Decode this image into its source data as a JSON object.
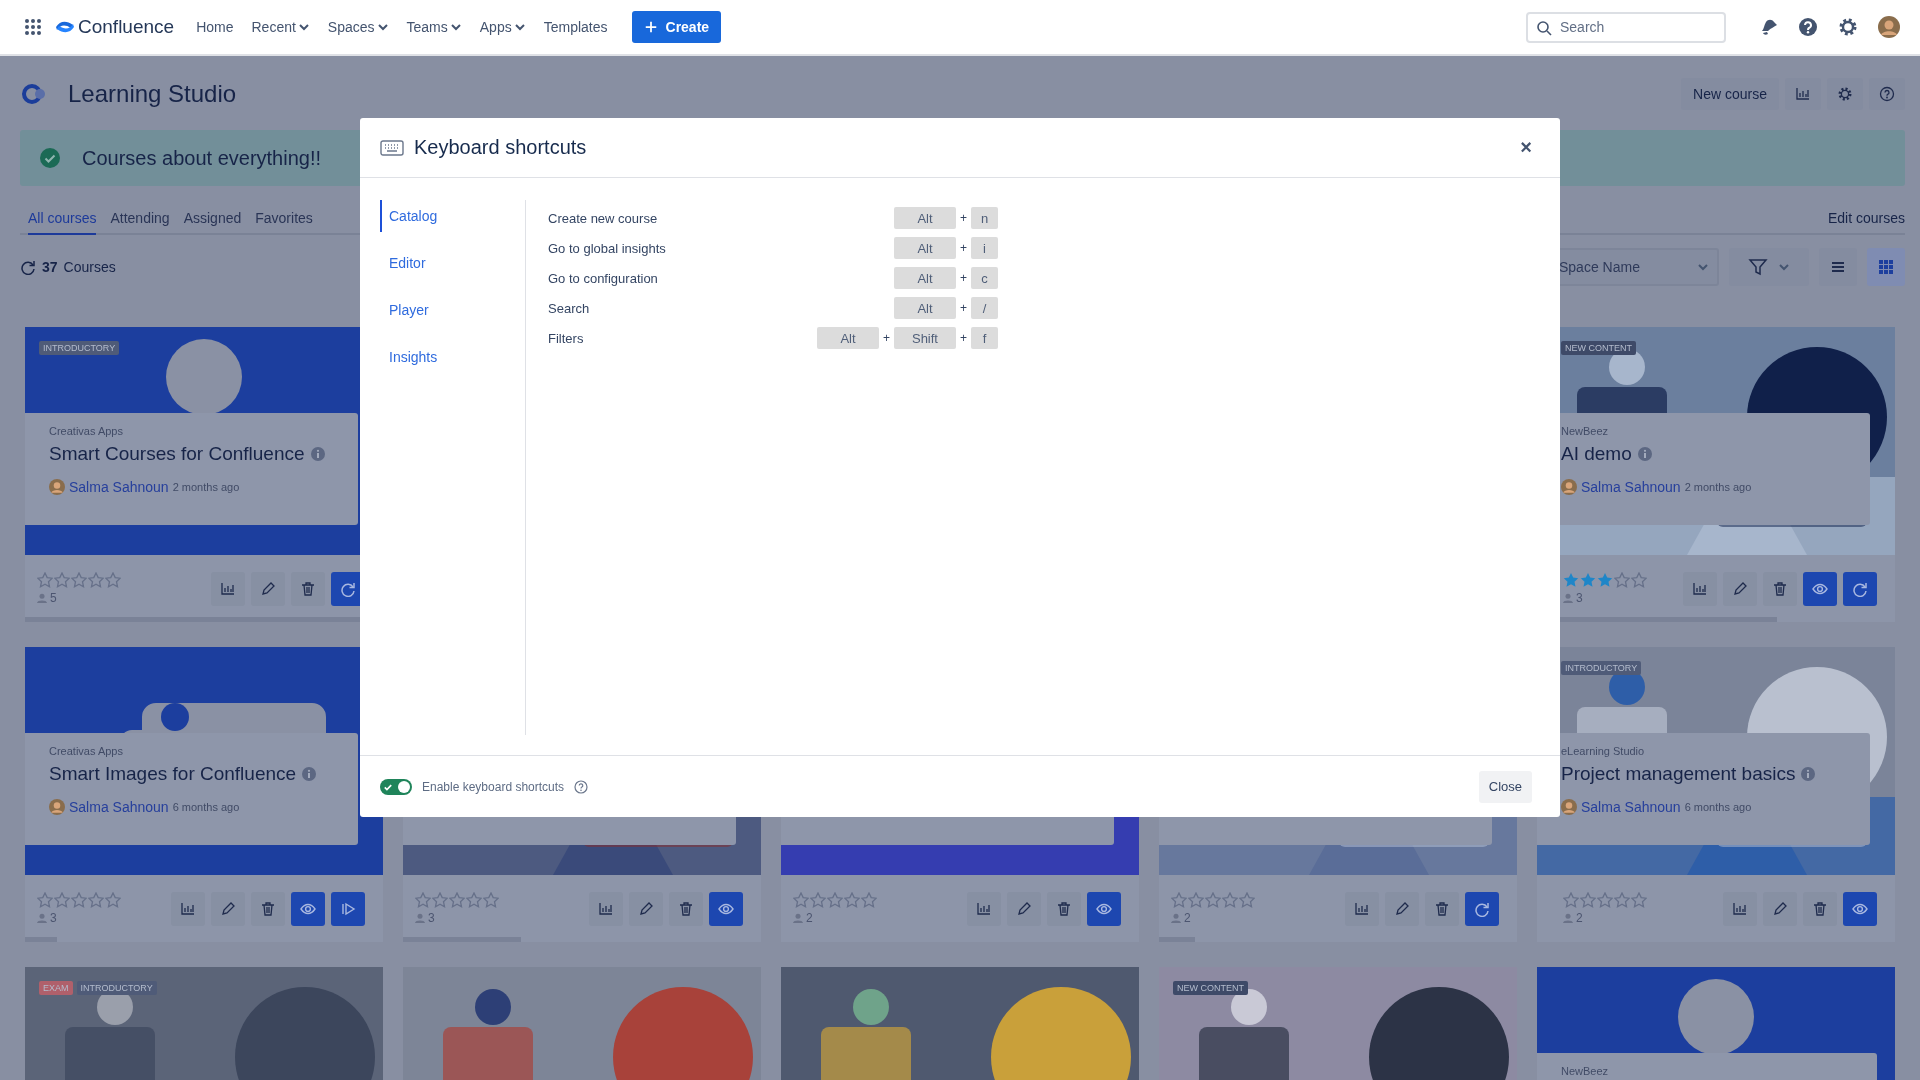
{
  "nav": {
    "items": [
      {
        "label": "Home",
        "dropdown": false
      },
      {
        "label": "Recent",
        "dropdown": true
      },
      {
        "label": "Spaces",
        "dropdown": true
      },
      {
        "label": "Teams",
        "dropdown": true
      },
      {
        "label": "Apps",
        "dropdown": true
      },
      {
        "label": "Templates",
        "dropdown": false
      }
    ],
    "brand": "Confluence",
    "create": "Create",
    "search": {
      "placeholder": "Search"
    }
  },
  "app": {
    "title": "Learning Studio",
    "new_course": "New course",
    "banner": "Courses about everything!!"
  },
  "tabs": [
    {
      "label": "All courses",
      "selected": true
    },
    {
      "label": "Attending",
      "selected": false
    },
    {
      "label": "Assigned",
      "selected": false
    },
    {
      "label": "Favorites",
      "selected": false
    }
  ],
  "edit_courses": "Edit courses",
  "course_count": {
    "number": "37",
    "label": "Courses"
  },
  "space_filter": {
    "placeholder": "Space Name"
  },
  "views": [
    {
      "kind": "list",
      "selected": false
    },
    {
      "kind": "grid",
      "selected": true
    }
  ],
  "cards": [
    {
      "kind": "course",
      "tags": [
        {
          "label": "INTRODUCTORY",
          "color": "#4f5b78"
        }
      ],
      "provider": "Creativas Apps",
      "title": "Smart Courses for Confluence",
      "author": "Salma Sahnoun",
      "time": "2 months ago",
      "stars": 0,
      "participants": "5",
      "actions": [
        {
          "kind": "chart",
          "primary": false
        },
        {
          "kind": "pencil",
          "primary": false
        },
        {
          "kind": "trash",
          "primary": false
        },
        {
          "kind": "refresh",
          "primary": true
        }
      ],
      "progress": {
        "level": 1
      }
    },
    {
      "kind": "hidden"
    },
    {
      "kind": "hidden"
    },
    {
      "kind": "hidden"
    },
    {
      "kind": "course",
      "tags": [
        {
          "label": "NEW CONTENT",
          "color": "#3e4a68"
        }
      ],
      "provider": "NewBeez",
      "title": "AI demo",
      "author": "Salma Sahnoun",
      "time": "2 months ago",
      "stars": 3,
      "participants": "3",
      "actions": [
        {
          "kind": "chart",
          "primary": false
        },
        {
          "kind": "pencil",
          "primary": false
        },
        {
          "kind": "trash",
          "primary": false
        },
        {
          "kind": "eye",
          "primary": true
        },
        {
          "kind": "refresh",
          "primary": true
        }
      ],
      "progress": {
        "level": 0.67
      }
    },
    {
      "kind": "course",
      "provider": "Creativas Apps",
      "title": "Smart Images for Confluence",
      "author": "Salma Sahnoun",
      "time": "6 months ago",
      "stars": 0,
      "participants": "3",
      "actions": [
        {
          "kind": "chart",
          "primary": false
        },
        {
          "kind": "pencil",
          "primary": false
        },
        {
          "kind": "trash",
          "primary": false
        },
        {
          "kind": "eye",
          "primary": true
        },
        {
          "kind": "play",
          "primary": true
        }
      ],
      "progress": {
        "level": 0.09
      }
    },
    {
      "kind": "course",
      "stars": 0,
      "participants": "3",
      "actions": [
        {
          "kind": "chart",
          "primary": false
        },
        {
          "kind": "pencil",
          "primary": false
        },
        {
          "kind": "trash",
          "primary": false
        },
        {
          "kind": "eye",
          "primary": true
        }
      ],
      "progress": {
        "level": 0.33
      }
    },
    {
      "kind": "course",
      "stars": 0,
      "participants": "2",
      "actions": [
        {
          "kind": "chart",
          "primary": false
        },
        {
          "kind": "pencil",
          "primary": false
        },
        {
          "kind": "trash",
          "primary": false
        },
        {
          "kind": "eye",
          "primary": true
        }
      ]
    },
    {
      "kind": "course",
      "stars": 0,
      "participants": "2",
      "actions": [
        {
          "kind": "chart",
          "primary": false
        },
        {
          "kind": "pencil",
          "primary": false
        },
        {
          "kind": "trash",
          "primary": false
        },
        {
          "kind": "refresh",
          "primary": true
        }
      ],
      "progress": {
        "level": 0.1
      }
    },
    {
      "kind": "course",
      "tags": [
        {
          "label": "INTRODUCTORY",
          "color": "#4f5b78"
        }
      ],
      "provider": "eLearning Studio",
      "title": "Project management basics",
      "author": "Salma Sahnoun",
      "time": "6 months ago",
      "stars": 0,
      "participants": "2",
      "actions": [
        {
          "kind": "chart",
          "primary": false
        },
        {
          "kind": "pencil",
          "primary": false
        },
        {
          "kind": "trash",
          "primary": false
        },
        {
          "kind": "eye",
          "primary": true
        }
      ]
    },
    {
      "kind": "teaser",
      "tags": [
        {
          "label": "EXAM",
          "color": "#b0606b"
        },
        {
          "label": "INTRODUCTORY",
          "color": "#4f5b78"
        }
      ]
    },
    {
      "kind": "teaser"
    },
    {
      "kind": "teaser"
    },
    {
      "kind": "teaser",
      "tags": [
        {
          "label": "NEW CONTENT",
          "color": "#3e4a68"
        }
      ]
    },
    {
      "kind": "teaser",
      "provider": "NewBeez"
    }
  ],
  "modal": {
    "title": "Keyboard shortcuts",
    "close": "×",
    "sections": [
      {
        "label": "Catalog",
        "selected": true
      },
      {
        "label": "Editor",
        "selected": false
      },
      {
        "label": "Player",
        "selected": false
      },
      {
        "label": "Insights",
        "selected": false
      }
    ],
    "shortcuts": [
      {
        "action": "Create new course",
        "keys": [
          "Alt",
          "+",
          "n"
        ]
      },
      {
        "action": "Go to global insights",
        "keys": [
          "Alt",
          "+",
          "i"
        ]
      },
      {
        "action": "Go to configuration",
        "keys": [
          "Alt",
          "+",
          "c"
        ]
      },
      {
        "action": "Search",
        "keys": [
          "Alt",
          "+",
          "/"
        ]
      },
      {
        "action": "Filters",
        "keys": [
          "Alt",
          "+",
          "Shift",
          "+",
          "f"
        ]
      }
    ],
    "toggle": {
      "label": "Enable keyboard shortcuts",
      "on": true
    },
    "close_button": "Close"
  }
}
